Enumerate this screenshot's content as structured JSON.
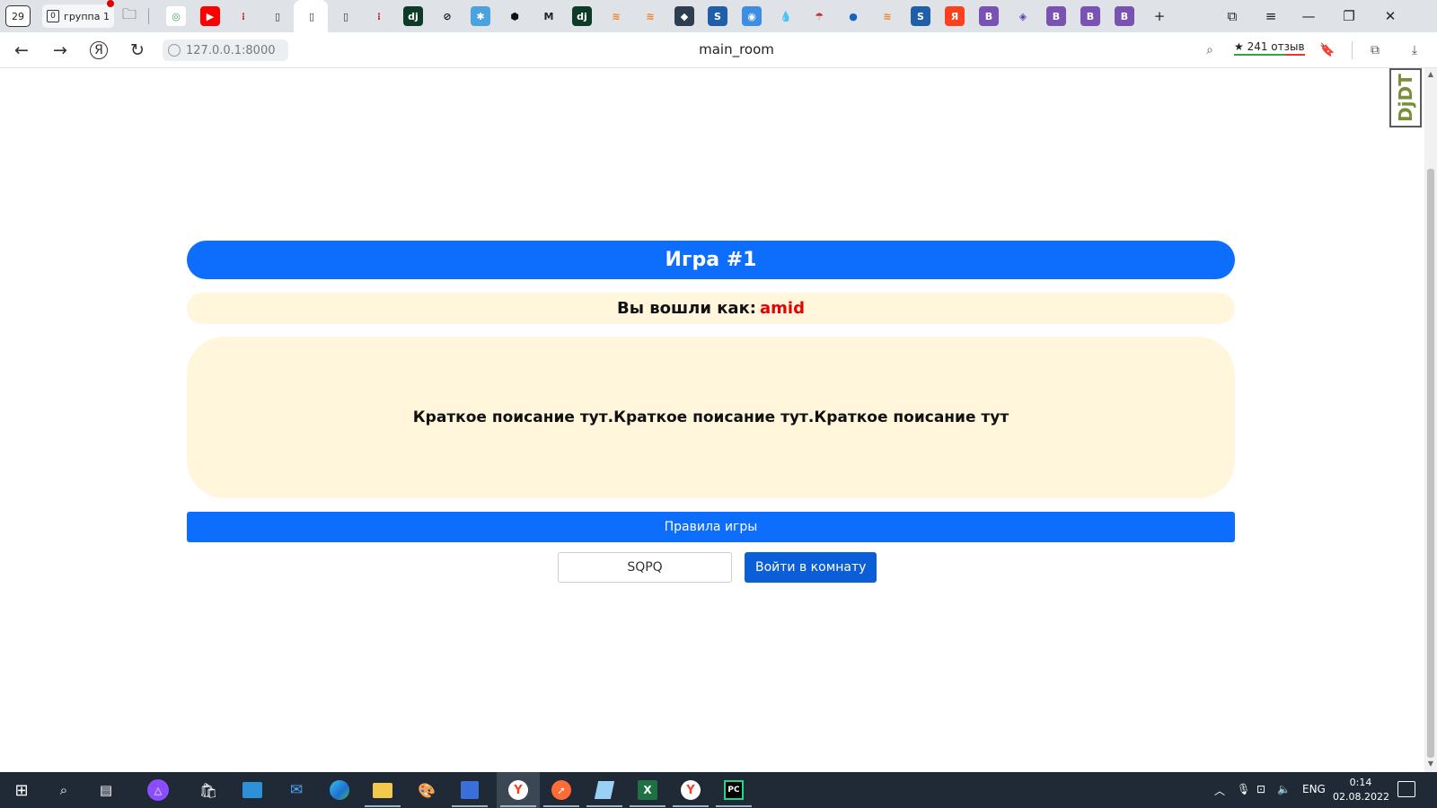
{
  "tabstrip": {
    "tab_count": "29",
    "group_label": "группа 1",
    "group_tab_count": "0",
    "tabs": [
      {
        "icon": "loop-icon",
        "bg": "#ffffff",
        "fg": "#3aa757",
        "glyph": "◎"
      },
      {
        "icon": "youtube-icon",
        "bg": "#ff0000",
        "fg": "#ffffff",
        "glyph": "▶"
      },
      {
        "icon": "dot-red-icon",
        "bg": "transparent",
        "fg": "#c62828",
        "glyph": "⁝"
      },
      {
        "icon": "page-icon",
        "bg": "transparent",
        "fg": "#333333",
        "glyph": "▯"
      },
      {
        "icon": "page-icon",
        "bg": "transparent",
        "fg": "#333333",
        "glyph": "▯"
      },
      {
        "icon": "page-icon",
        "bg": "transparent",
        "fg": "#333333",
        "glyph": "▯"
      },
      {
        "icon": "dot-red-icon",
        "bg": "transparent",
        "fg": "#c62828",
        "glyph": "⁝"
      },
      {
        "icon": "django-icon",
        "bg": "#0c3c26",
        "fg": "#ffffff",
        "glyph": "dj"
      },
      {
        "icon": "stripe-circle-icon",
        "bg": "transparent",
        "fg": "#111111",
        "glyph": "⊘"
      },
      {
        "icon": "puzzle-icon",
        "bg": "#4aa3df",
        "fg": "#ffffff",
        "glyph": "✱"
      },
      {
        "icon": "codepen-icon",
        "bg": "transparent",
        "fg": "#111111",
        "glyph": "⬢"
      },
      {
        "icon": "medium-icon",
        "bg": "transparent",
        "fg": "#222222",
        "glyph": "M"
      },
      {
        "icon": "django-icon",
        "bg": "#0c3c26",
        "fg": "#ffffff",
        "glyph": "dj"
      },
      {
        "icon": "stackoverflow-icon",
        "bg": "transparent",
        "fg": "#f48024",
        "glyph": "≋"
      },
      {
        "icon": "stackoverflow-icon",
        "bg": "transparent",
        "fg": "#f48024",
        "glyph": "≋"
      },
      {
        "icon": "app-icon",
        "bg": "#2c3e50",
        "fg": "#ffffff",
        "glyph": "◆"
      },
      {
        "icon": "book-icon",
        "bg": "#1e5fa8",
        "fg": "#ffffff",
        "glyph": "S"
      },
      {
        "icon": "camera-icon",
        "bg": "#3d8ee0",
        "fg": "#ffffff",
        "glyph": "◉"
      },
      {
        "icon": "drop-icon",
        "bg": "transparent",
        "fg": "#1e88e5",
        "glyph": "💧"
      },
      {
        "icon": "umbrella-icon",
        "bg": "transparent",
        "fg": "#d32f2f",
        "glyph": "☂"
      },
      {
        "icon": "drop-dark-icon",
        "bg": "transparent",
        "fg": "#1565c0",
        "glyph": "●"
      },
      {
        "icon": "stackoverflow-icon",
        "bg": "transparent",
        "fg": "#f48024",
        "glyph": "≋"
      },
      {
        "icon": "book-icon",
        "bg": "#1e5fa8",
        "fg": "#ffffff",
        "glyph": "S"
      },
      {
        "icon": "yandex-icon",
        "bg": "#fc3f1d",
        "fg": "#ffffff",
        "glyph": "Я"
      },
      {
        "icon": "bootstrap-icon",
        "bg": "#7952b3",
        "fg": "#ffffff",
        "glyph": "B"
      },
      {
        "icon": "layers-icon",
        "bg": "transparent",
        "fg": "#5b3cc4",
        "glyph": "◈"
      },
      {
        "icon": "bootstrap-icon",
        "bg": "#7952b3",
        "fg": "#ffffff",
        "glyph": "B"
      },
      {
        "icon": "bootstrap-icon",
        "bg": "#7952b3",
        "fg": "#ffffff",
        "glyph": "B"
      },
      {
        "icon": "bootstrap-icon",
        "bg": "#7952b3",
        "fg": "#ffffff",
        "glyph": "B"
      }
    ],
    "new_tab_glyph": "+"
  },
  "addressbar": {
    "url": "127.0.0.1:8000",
    "page_title": "main_room",
    "reviews": "★ 241 отзыв"
  },
  "page": {
    "game_title": "Игра #1",
    "login_prefix": "Вы вошли как:",
    "username": "amid",
    "description": "Краткое поисание тут.Краткое поисание тут.Краткое поисание тут",
    "rules_button": "Правила игры",
    "room_code_value": "SQPQ",
    "join_button": "Войти в комнату",
    "accent_color": "#0d6efd",
    "username_color": "#e80000",
    "panel_color": "#fff6dc"
  },
  "debug_toolbar": {
    "label": "DjDT"
  },
  "taskbar": {
    "language": "ENG",
    "time": "0:14",
    "date": "02.08.2022"
  }
}
